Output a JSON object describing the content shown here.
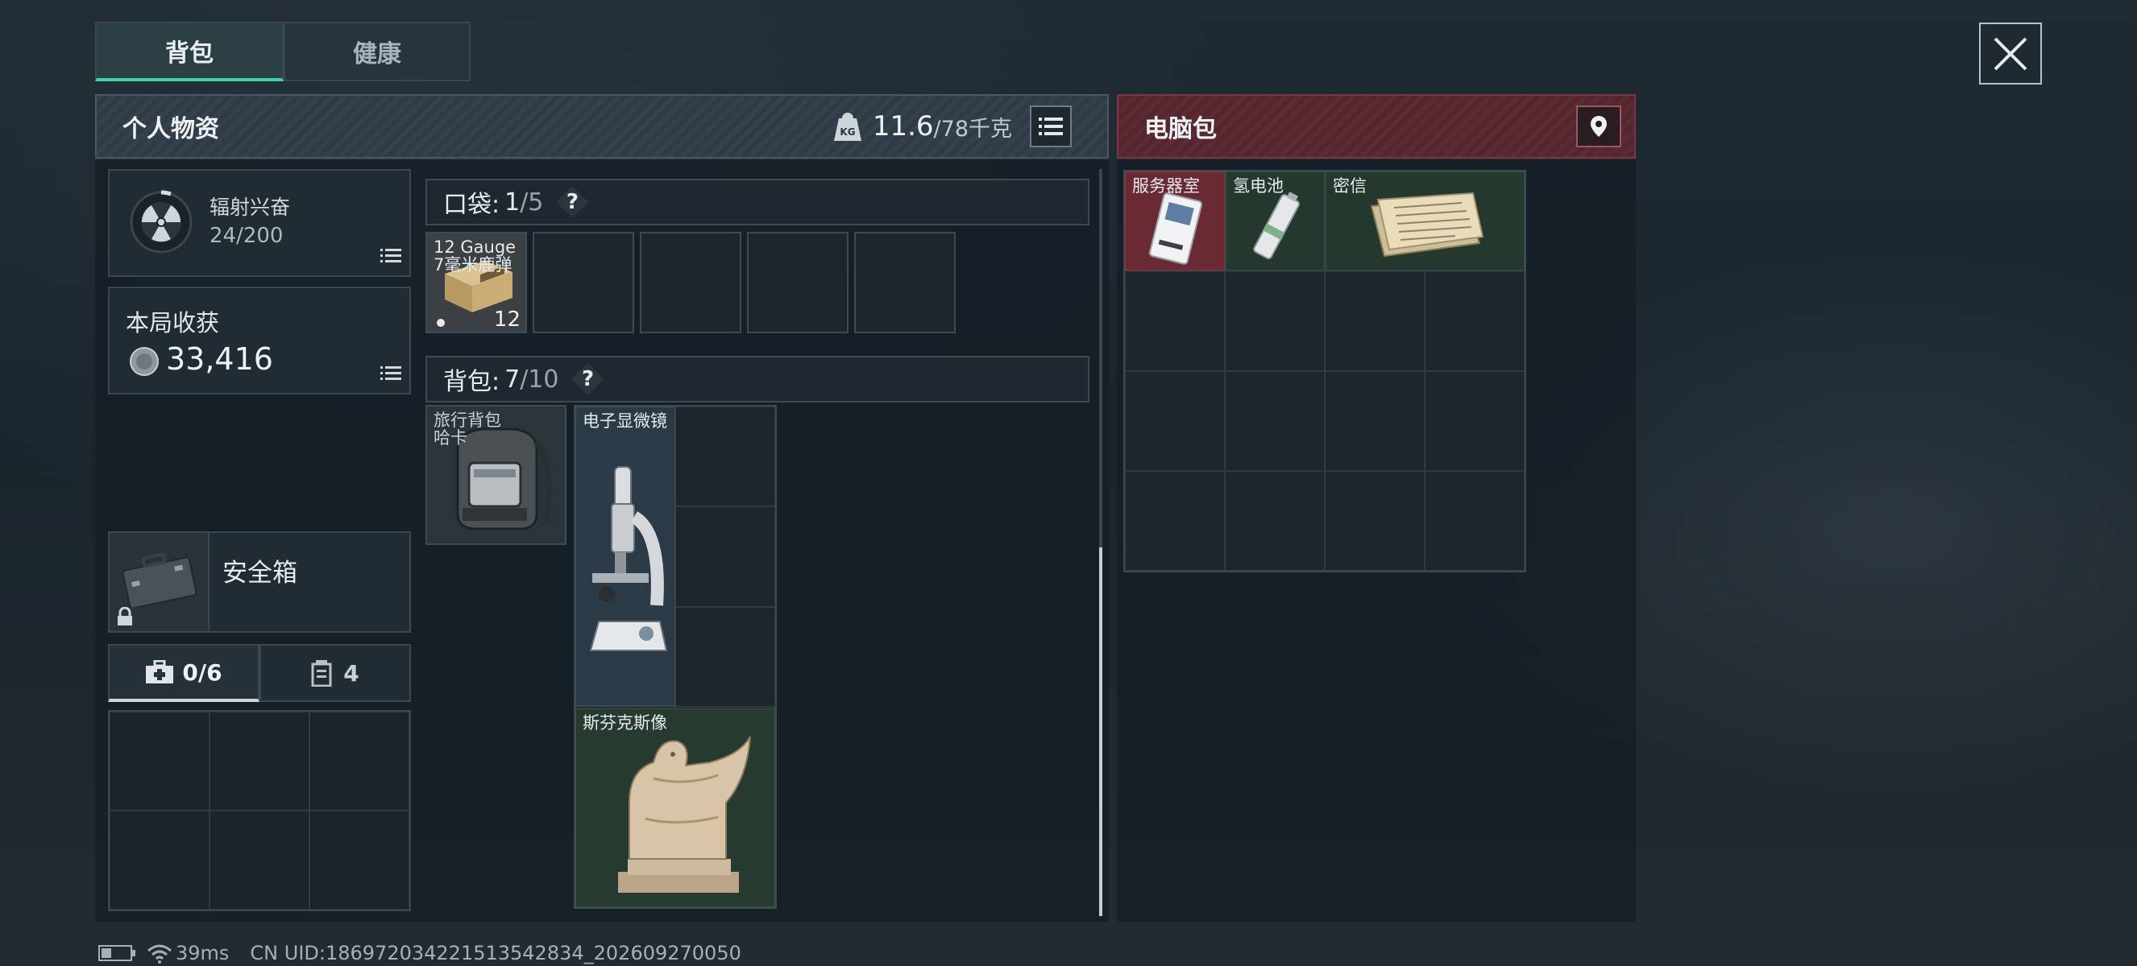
{
  "tabs": {
    "backpack": "背包",
    "health": "健康"
  },
  "personal": {
    "title": "个人物资",
    "weight_current": "11.6",
    "weight_max": "/78千克",
    "weight_icon": "kettlebell-icon"
  },
  "radiation": {
    "label": "辐射兴奋",
    "value": "24/200"
  },
  "harvest": {
    "label": "本局收获",
    "value": "33,416"
  },
  "safe_box": {
    "label": "安全箱"
  },
  "subtabs": {
    "first": "0/6",
    "second": "4"
  },
  "pocket": {
    "label": "口袋:",
    "current": "1",
    "max": "/5",
    "help": "?"
  },
  "pocket_item": {
    "name": "12 Gauge 7毫米鹿弹",
    "count": "12"
  },
  "backpack": {
    "label": "背包:",
    "current": "7",
    "max": "/10",
    "help": "?"
  },
  "backpack_items": {
    "travel_pack": "旅行背包 哈卡",
    "microscope": "电子显微镜",
    "sphinx": "斯芬克斯像"
  },
  "computer_bag": {
    "title": "电脑包",
    "items": {
      "server": "服务器室",
      "battery": "氢电池",
      "letter": "密信"
    }
  },
  "status": {
    "ping": "39ms",
    "uid": "CN UID:1869720342215135428­34_202609270050"
  },
  "colors": {
    "accent": "#3fd3a3",
    "pc_header": "#5b2a33",
    "rare_red": "#6a2a33",
    "green_cell": "#27402f"
  }
}
